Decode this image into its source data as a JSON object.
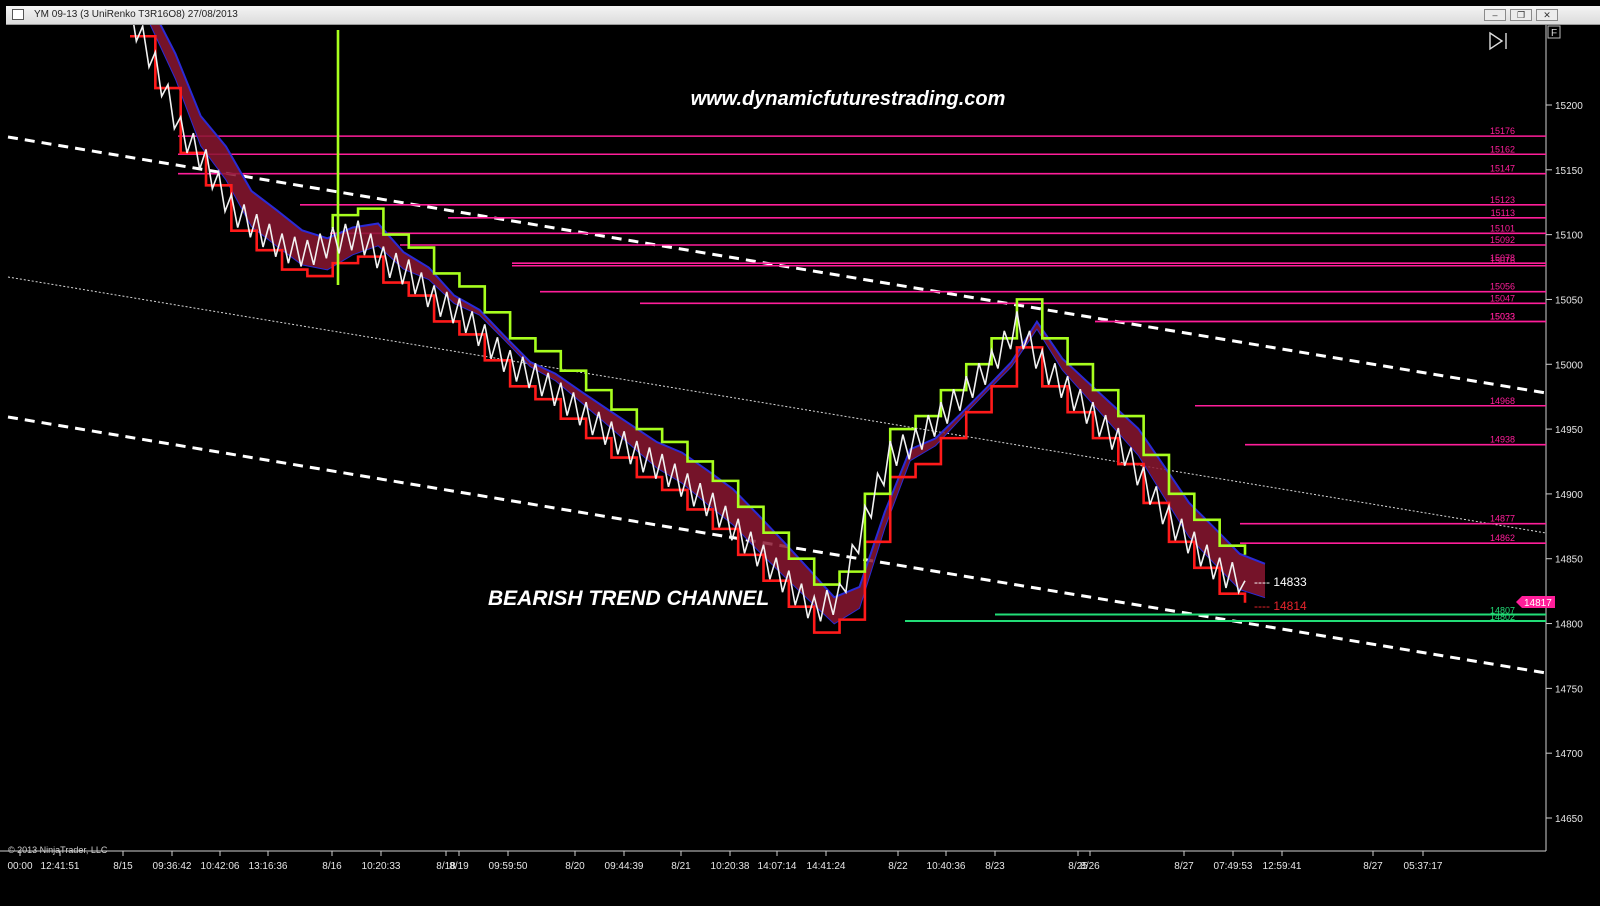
{
  "window": {
    "title": "YM 09-13 (3 UniRenko T3R16O8)  27/08/2013",
    "buttons": [
      "minimize",
      "restore",
      "close"
    ]
  },
  "chart": {
    "website_text": "www.dynamicfuturestrading.com",
    "annotation": "BEARISH TREND CHANNEL",
    "copyright": "© 2013 NinjaTrader, LLC",
    "panel_button": "F",
    "current_price_marker": "14817",
    "line_labels": [
      {
        "price": 14833,
        "text": "---- 14833",
        "color": "#ffffff"
      },
      {
        "price": 14814,
        "text": "---- 14814",
        "color": "#e8242c"
      }
    ],
    "level_labels": {
      "magenta": [
        "15176",
        "15162",
        "15147",
        "15123",
        "15113",
        "15101",
        "15092",
        "15078",
        "15076",
        "15056",
        "15047",
        "15033",
        "15033",
        "14968",
        "14938",
        "14877",
        "14862"
      ],
      "green": [
        "14807",
        "14802"
      ]
    },
    "colors": {
      "magenta": "#ff1e9a",
      "green": "#22dd77",
      "lime": "#a8ff1e",
      "red": "#ff1a1a",
      "blue": "#2b2bd6",
      "maroon": "#8a1630",
      "olive": "#6b9a10"
    }
  },
  "chart_data": {
    "type": "line",
    "y_axis_ticks": [
      "15200",
      "15150",
      "15100",
      "15050",
      "15000",
      "14950",
      "14900",
      "14850",
      "14800",
      "14750",
      "14700",
      "14650"
    ],
    "x_axis_ticks": [
      "00:00",
      "12:41:51",
      "8/15",
      "09:36:42",
      "10:42:06",
      "13:16:36",
      "8/16",
      "10:20:33",
      "8/18",
      "8/19",
      "09:59:50",
      "8/20",
      "09:44:39",
      "8/21",
      "10:20:38",
      "14:07:14",
      "14:41:24",
      "8/22",
      "10:40:36",
      "8/23",
      "8/25",
      "8/26",
      "8/27",
      "07:49:53",
      "12:59:41",
      "8/27",
      "05:37:17"
    ],
    "ylim": [
      14610,
      15250
    ],
    "horizontal_levels": [
      15176,
      15162,
      15147,
      15123,
      15113,
      15101,
      15092,
      15078,
      15076,
      15056,
      15047,
      15033,
      15033,
      14968,
      14938,
      14877,
      14862,
      14807,
      14802
    ],
    "price_series_close": [
      15270,
      15230,
      15180,
      15155,
      15120,
      15105,
      15090,
      15085,
      15095,
      15100,
      15080,
      15070,
      15050,
      15040,
      15020,
      15000,
      14990,
      14975,
      14960,
      14945,
      14930,
      14920,
      14905,
      14890,
      14870,
      14850,
      14830,
      14810,
      14820,
      14880,
      14930,
      14940,
      14960,
      14980,
      15000,
      15030,
      15000,
      14980,
      14960,
      14940,
      14910,
      14880,
      14860,
      14840,
      14833
    ]
  }
}
